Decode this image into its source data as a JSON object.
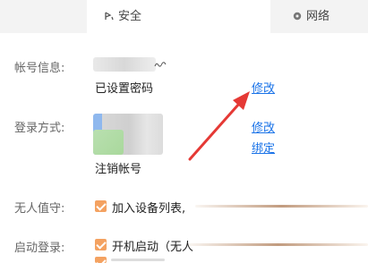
{
  "tabs": {
    "security": "安全",
    "network": "网络"
  },
  "account": {
    "label": "帐号信息:",
    "password_status": "已设置密码",
    "modify_link": "修改"
  },
  "login": {
    "label": "登录方式:",
    "modify_link": "修改",
    "bind_link": "绑定",
    "deregister": "注销帐号"
  },
  "unattended": {
    "label": "无人值守:",
    "option": "加入设备列表,"
  },
  "startup": {
    "label": "启动登录:",
    "option": "开机启动（无人"
  },
  "colors": {
    "link": "#1a73e8",
    "checkbox": "#f4a261",
    "arrow": "#e53935"
  }
}
